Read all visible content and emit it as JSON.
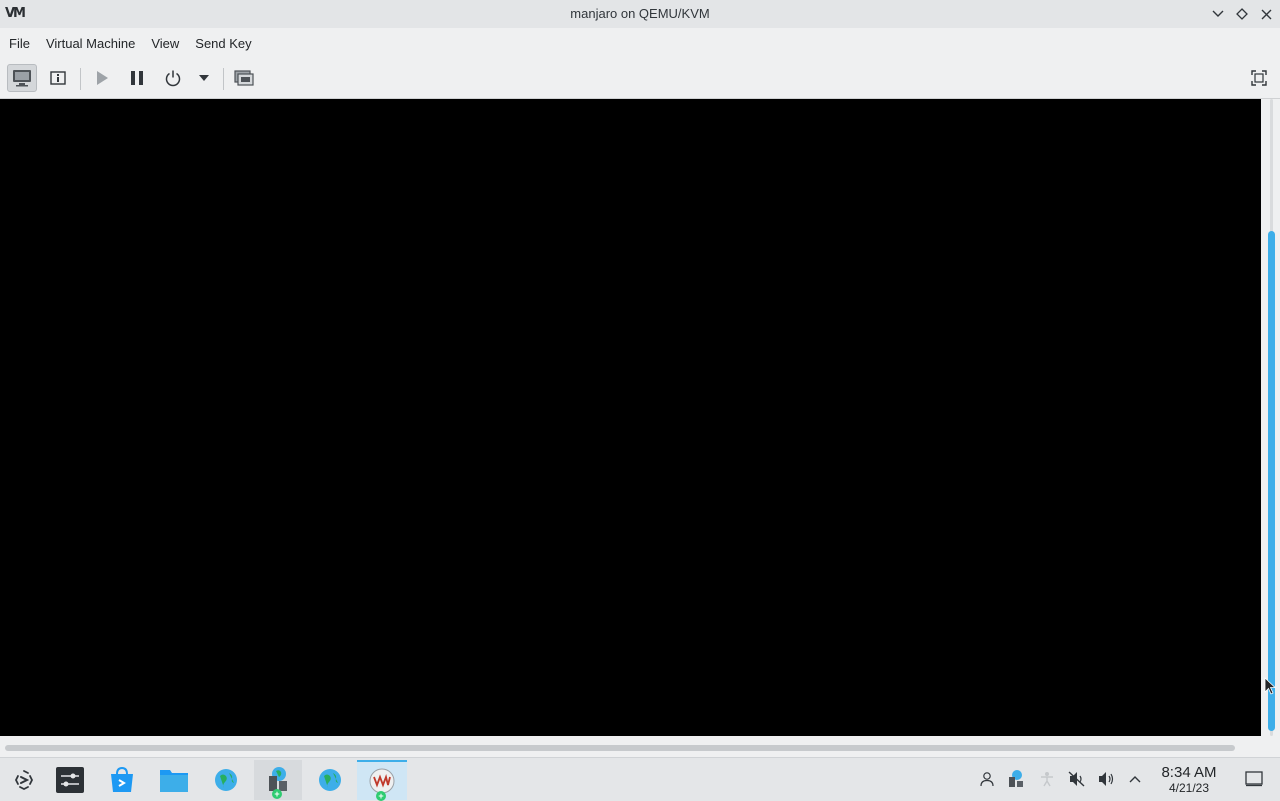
{
  "window": {
    "logo_text": "VM",
    "title": "manjaro on QEMU/KVM"
  },
  "menubar": {
    "items": [
      "File",
      "Virtual Machine",
      "View",
      "Send Key"
    ]
  },
  "toolbar": {
    "buttons": [
      "console-view",
      "details-view",
      "run",
      "pause",
      "shutdown",
      "shutdown-menu",
      "snapshots",
      "fullscreen"
    ]
  },
  "scrollbars": {
    "accent": "#3daee9"
  },
  "taskbar": {
    "apps": [
      "application-launcher",
      "system-settings",
      "discover",
      "file-manager",
      "network-manager",
      "virt-manager",
      "network-manager-2",
      "virt-viewer"
    ],
    "clock": {
      "time": "8:34 AM",
      "date": "4/21/23"
    }
  },
  "colors": {
    "console_bg": "#000000",
    "chrome_bg": "#eff0f1",
    "accent": "#3daee9"
  }
}
